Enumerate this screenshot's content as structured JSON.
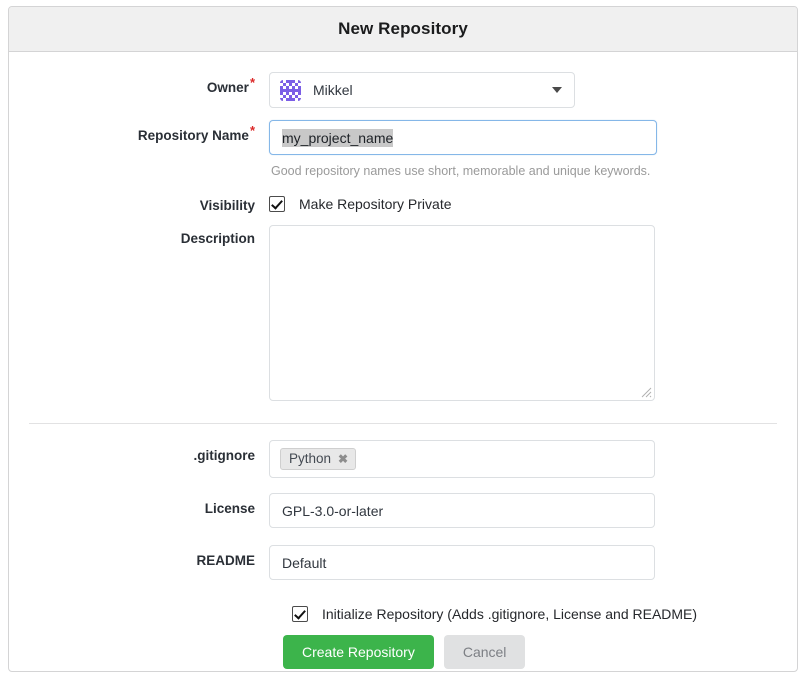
{
  "card": {
    "title": "New Repository"
  },
  "form": {
    "owner": {
      "label": "Owner",
      "required_marker": "*",
      "avatar_name": "identicon-avatar",
      "value": "Mikkel",
      "caret_icon": "chevron-down-icon"
    },
    "repository_name": {
      "label": "Repository Name",
      "required_marker": "*",
      "value": "my_project_name",
      "placeholder": "",
      "helper": "Good repository names use short, memorable and unique keywords.",
      "selected": true,
      "focused": true
    },
    "visibility": {
      "label": "Visibility",
      "checkbox_label": "Make Repository Private",
      "checked": true
    },
    "description": {
      "label": "Description",
      "value": "",
      "placeholder": "",
      "resize_icon": "resize-handle-icon"
    },
    "gitignore": {
      "label": ".gitignore",
      "tags": [
        {
          "label": "Python",
          "remove_icon": "close-icon",
          "remove_glyph": "✖"
        }
      ]
    },
    "license": {
      "label": "License",
      "value": "GPL-3.0-or-later"
    },
    "readme": {
      "label": "README",
      "value": "Default"
    },
    "initialize": {
      "checkbox_label": "Initialize Repository (Adds .gitignore, License and README)",
      "checked": true
    }
  },
  "actions": {
    "create_label": "Create Repository",
    "cancel_label": "Cancel"
  },
  "colors": {
    "primary_green": "#3cb44b",
    "secondary_gray": "#e0e1e2",
    "header_bg": "#f0f0f0",
    "border": "#d4d4d5",
    "required_red": "#db2828",
    "focus_blue": "#85b7e8",
    "selection_gray": "#c8c8c8",
    "helper_gray": "#9a9a9a",
    "avatar_purple": "#7b5ee6"
  }
}
